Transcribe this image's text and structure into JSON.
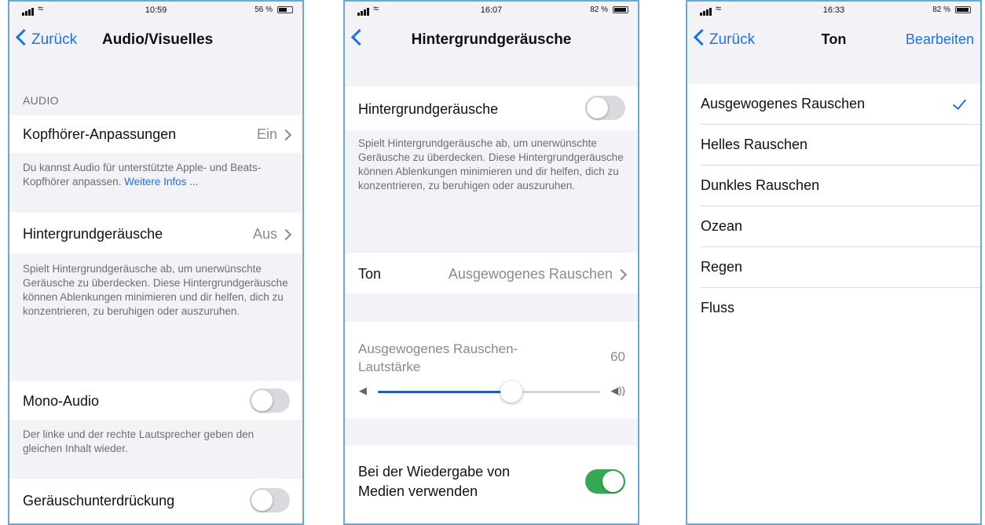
{
  "screens": [
    {
      "status": {
        "time": "10:59",
        "battery": "56 %",
        "battery_level": 0.56
      },
      "nav": {
        "back": "Zurück",
        "title": "Audio/Visuelles"
      },
      "section_header": "AUDIO",
      "kopfhoerer": {
        "label": "Kopfhörer-Anpassungen",
        "value": "Ein"
      },
      "kopfhoerer_footer": "Du kannst Audio für unterstützte Apple- und Beats-Kopfhörer anpassen. ",
      "kopfhoerer_link": "Weitere Infos ...",
      "hintergrund": {
        "label": "Hintergrundgeräusche",
        "value": "Aus"
      },
      "hintergrund_footer": "Spielt Hintergrundgeräusche ab, um unerwünschte Geräusche zu überdecken. Diese Hintergrundgeräusche können Ablenkungen minimieren und dir helfen, dich zu konzentrieren, zu beruhigen oder auszuruhen.",
      "mono": {
        "label": "Mono-Audio",
        "on": false
      },
      "mono_footer": "Der linke und der rechte Lautsprecher geben den gleichen Inhalt wieder.",
      "noise": {
        "label": "Geräuschunterdrückung",
        "on": false
      }
    },
    {
      "status": {
        "time": "16:07",
        "battery": "82 %",
        "battery_level": 0.82
      },
      "nav": {
        "title": "Hintergrundgeräusche"
      },
      "toggle_row": {
        "label": "Hintergrundgeräusche",
        "on": false
      },
      "toggle_footer": "Spielt Hintergrundgeräusche ab, um unerwünschte Geräusche zu überdecken. Diese Hintergrundgeräusche können Ablenkungen minimieren und dir helfen, dich zu konzentrieren, zu beruhigen oder auszuruhen.",
      "ton": {
        "label": "Ton",
        "value": "Ausgewogenes Rauschen"
      },
      "volume": {
        "label": "Ausgewogenes Rauschen-Lautstärke",
        "value": "60",
        "level": 0.6
      },
      "media": {
        "label": "Bei der Wiedergabe von Medien verwenden",
        "on": true
      }
    },
    {
      "status": {
        "time": "16:33",
        "battery": "82 %",
        "battery_level": 0.82
      },
      "nav": {
        "back": "Zurück",
        "title": "Ton",
        "action": "Bearbeiten"
      },
      "options": [
        {
          "label": "Ausgewogenes Rauschen",
          "selected": true
        },
        {
          "label": "Helles Rauschen",
          "selected": false
        },
        {
          "label": "Dunkles Rauschen",
          "selected": false
        },
        {
          "label": "Ozean",
          "selected": false
        },
        {
          "label": "Regen",
          "selected": false
        },
        {
          "label": "Fluss",
          "selected": false
        }
      ]
    }
  ]
}
